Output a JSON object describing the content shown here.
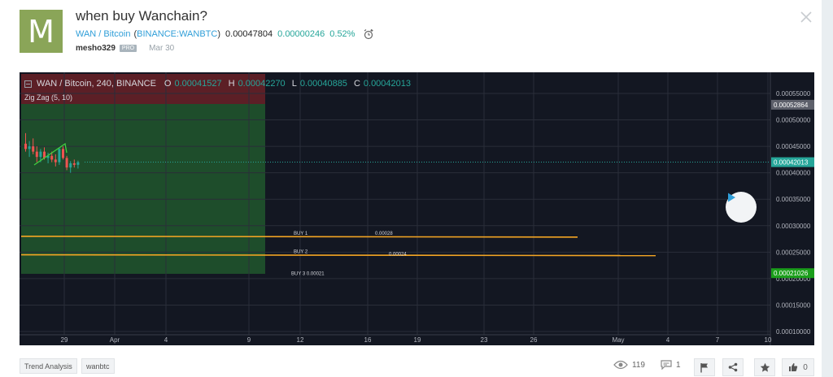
{
  "idea": {
    "avatar_letter": "M",
    "title": "when buy Wanchain?",
    "symbol_link": "WAN / Bitcoin",
    "exchange_link": "BINANCE:WANBTC",
    "price": "0.00047804",
    "change": "0.00000246",
    "change_pct": "0.52%",
    "author": "mesho329",
    "author_badge": "PRO",
    "date": "Mar 30"
  },
  "legend": {
    "symbol": "WAN / Bitcoin, 240, BINANCE",
    "o_label": "O",
    "o_value": "0.00041527",
    "h_label": "H",
    "h_value": "0.00042270",
    "l_label": "L",
    "l_value": "0.00040885",
    "c_label": "C",
    "c_value": "0.00042013",
    "indicator": "Zig Zag (5, 10)"
  },
  "chart_data": {
    "type": "line",
    "title": "WAN / Bitcoin, 240, BINANCE",
    "x_ticks": [
      "29",
      "Apr",
      "4",
      "9",
      "12",
      "16",
      "19",
      "23",
      "26",
      "May",
      "4",
      "7",
      "10"
    ],
    "y_ticks": [
      "0.00055000",
      "0.00050000",
      "0.00045000",
      "0.00040000",
      "0.00035000",
      "0.00030000",
      "0.00025000",
      "0.00020000",
      "0.00015000",
      "0.00010000"
    ],
    "ylim": [
      0.0001,
      0.00056
    ],
    "last_price_label": "0.00042013",
    "upper_marker_label": "0.00052864",
    "lower_marker_label": "0.00021026",
    "annotations": [
      {
        "text": "BUY 1",
        "value_text": "0.00028",
        "y": 0.00028
      },
      {
        "text": "BUY 2",
        "value_text": "0.00024",
        "y": 0.000245
      },
      {
        "text": "BUY 3 0.00021",
        "y": 0.00021
      }
    ],
    "candles": [
      {
        "o": 0.000455,
        "h": 0.000475,
        "l": 0.00044,
        "c": 0.000445
      },
      {
        "o": 0.000445,
        "h": 0.00046,
        "l": 0.00043,
        "c": 0.00045
      },
      {
        "o": 0.00045,
        "h": 0.000465,
        "l": 0.000435,
        "c": 0.00044
      },
      {
        "o": 0.00044,
        "h": 0.00045,
        "l": 0.00042,
        "c": 0.00043
      },
      {
        "o": 0.00043,
        "h": 0.000445,
        "l": 0.00042,
        "c": 0.00044
      },
      {
        "o": 0.00044,
        "h": 0.000448,
        "l": 0.000425,
        "c": 0.000428
      },
      {
        "o": 0.000428,
        "h": 0.000438,
        "l": 0.000418,
        "c": 0.000432
      },
      {
        "o": 0.000432,
        "h": 0.00044,
        "l": 0.00042,
        "c": 0.000425
      },
      {
        "o": 0.000425,
        "h": 0.000435,
        "l": 0.000412,
        "c": 0.00042
      },
      {
        "o": 0.00042,
        "h": 0.000448,
        "l": 0.000415,
        "c": 0.000445
      },
      {
        "o": 0.000445,
        "h": 0.00045,
        "l": 0.000425,
        "c": 0.000428
      },
      {
        "o": 0.000428,
        "h": 0.000432,
        "l": 0.000405,
        "c": 0.00041
      },
      {
        "o": 0.00041,
        "h": 0.000422,
        "l": 0.0004,
        "c": 0.000418
      },
      {
        "o": 0.000418,
        "h": 0.000425,
        "l": 0.00041,
        "c": 0.000415
      },
      {
        "o": 0.000415,
        "h": 0.000423,
        "l": 0.000408,
        "c": 0.00042
      }
    ],
    "colors": {
      "up": "#26a69a",
      "down": "#ef5350",
      "buy_lines": "#f5a623",
      "green_zone": "#1e4d2b",
      "red_zone": "#5c1f26"
    }
  },
  "tags": [
    "Trend Analysis",
    "wanbtc"
  ],
  "stats": {
    "views": "119",
    "comments": "1",
    "likes": "0"
  }
}
